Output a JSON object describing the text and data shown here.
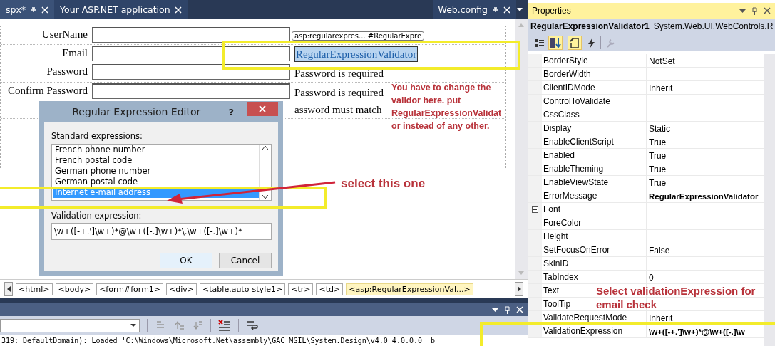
{
  "document_tabs": [
    {
      "label": "spx*",
      "selected": true,
      "pinned": true
    },
    {
      "label": "Your ASP.NET application",
      "selected": false,
      "pinned": false
    },
    {
      "label": "Web.config",
      "selected": false,
      "pinned": true
    }
  ],
  "designer": {
    "tag_chip": "asp:regularexpres... #RegularExpre",
    "rows": [
      {
        "label": "UserName",
        "messages": []
      },
      {
        "label": "Email",
        "messages": [
          {
            "text": "RegularExpressionValidator",
            "selected": true
          }
        ]
      },
      {
        "label": "Password",
        "messages": [
          {
            "text": "Password is required",
            "selected": false
          }
        ]
      },
      {
        "label": "Confirm Password",
        "messages": [
          {
            "text": "Password is required",
            "selected": false
          },
          {
            "text": "assword must match",
            "selected": false
          }
        ]
      }
    ]
  },
  "dialog": {
    "title": "Regular Expression Editor",
    "help": "?",
    "list_label": "Standard expressions:",
    "items": [
      {
        "label": "French phone number",
        "selected": false
      },
      {
        "label": "French postal code",
        "selected": false
      },
      {
        "label": "German phone number",
        "selected": false
      },
      {
        "label": "German postal code",
        "selected": false
      },
      {
        "label": "Internet e-mail address",
        "selected": true
      }
    ],
    "expression_label": "Validation expression:",
    "expression": "\\w+([-+.']\\w+)*@\\w+([-.]\\w+)*\\.\\w+([-.]\\w+)*",
    "buttons": [
      {
        "label": "OK",
        "default": true
      },
      {
        "label": "Cancel",
        "default": false
      }
    ]
  },
  "breadcrumb": [
    {
      "label": "<html>",
      "selected": false
    },
    {
      "label": "<body>",
      "selected": false
    },
    {
      "label": "<form#form1>",
      "selected": false
    },
    {
      "label": "<div>",
      "selected": false
    },
    {
      "label": "<table.auto-style1>",
      "selected": false
    },
    {
      "label": "<tr>",
      "selected": false
    },
    {
      "label": "<td>",
      "selected": false
    },
    {
      "label": "<asp:RegularExpressionVal...>",
      "selected": true
    }
  ],
  "output": {
    "line": "319: DefaultDomain): Loaded 'C:\\Windows\\Microsoft.Net\\assembly\\GAC_MSIL\\System.Design\\v4.0_4.0.0.0__b"
  },
  "properties": {
    "title": "Properties",
    "object_name": "RegularExpressionValidator1",
    "object_type": "System.Web.UI.WebControls.R",
    "toolbar": [
      {
        "kind": "categorized",
        "selected": false
      },
      {
        "kind": "alphabetical",
        "selected": true
      },
      {
        "kind": "properties",
        "selected": true
      },
      {
        "kind": "events",
        "selected": false
      },
      {
        "kind": "pages",
        "selected": false
      }
    ],
    "rows": [
      {
        "name": "BorderStyle",
        "value": "NotSet",
        "modified": false,
        "expandable": false
      },
      {
        "name": "BorderWidth",
        "expandable": false
      },
      {
        "name": "ClientIDMode",
        "value": "Inherit",
        "modified": false,
        "expandable": false
      },
      {
        "name": "ControlToValidate",
        "expandable": false
      },
      {
        "name": "CssClass",
        "expandable": false
      },
      {
        "name": "Display",
        "value": "Static",
        "modified": false,
        "expandable": false
      },
      {
        "name": "EnableClientScript",
        "value": "True",
        "modified": false,
        "expandable": false
      },
      {
        "name": "Enabled",
        "value": "True",
        "modified": false,
        "expandable": false
      },
      {
        "name": "EnableTheming",
        "value": "True",
        "modified": false,
        "expandable": false
      },
      {
        "name": "EnableViewState",
        "value": "True",
        "modified": false,
        "expandable": false
      },
      {
        "name": "ErrorMessage",
        "value": "RegularExpressionValidator",
        "modified": true,
        "expandable": false
      },
      {
        "name": "Font",
        "expandable": true
      },
      {
        "name": "ForeColor",
        "expandable": false
      },
      {
        "name": "Height",
        "expandable": false
      },
      {
        "name": "SetFocusOnError",
        "value": "False",
        "modified": false,
        "expandable": false
      },
      {
        "name": "SkinID",
        "expandable": false
      },
      {
        "name": "TabIndex",
        "value": "0",
        "modified": false,
        "expandable": false
      },
      {
        "name": "Text",
        "expandable": false
      },
      {
        "name": "ToolTip",
        "expandable": false
      },
      {
        "name": "ValidateRequestMode",
        "value": "Inherit",
        "modified": false,
        "expandable": false
      },
      {
        "name": "ValidationExpression",
        "value": "\\w+([-+.']\\w+)*@\\w+([-.]\\w",
        "modified": true,
        "expandable": false
      }
    ]
  },
  "annotations": {
    "note_lines": [
      "You have to change the",
      "validor here. put",
      "RegularExpressionValidat",
      "or instead of any other."
    ],
    "pointer_note": "select this one",
    "property_note_lines": [
      "Select validationExpression for",
      "email check"
    ]
  }
}
